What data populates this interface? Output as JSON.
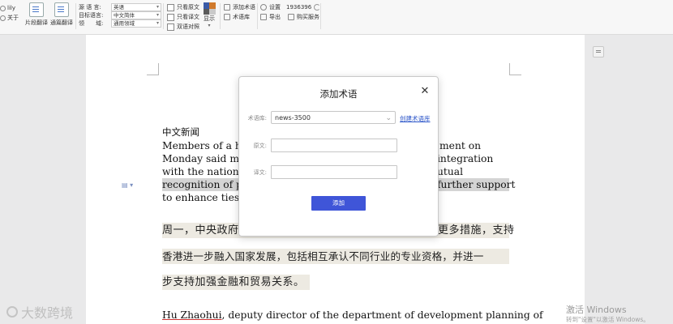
{
  "toolbar": {
    "user": "lily",
    "about": "关于",
    "segment_translate": "片段翻译",
    "full_translate": "通篇翻译",
    "source_lang_label": "源 语 言:",
    "source_lang_value": "英语",
    "target_lang_label": "目标语言:",
    "target_lang_value": "中文简体",
    "domain_label": "领　　域:",
    "domain_value": "通用领域",
    "view_source_only": "只看原文",
    "view_target_only": "只看译文",
    "bilingual_compare": "双语对照",
    "display": "显示",
    "add_term": "添加术语",
    "term_base": "术语库",
    "settings": "设置",
    "export": "导出",
    "credits": "1936396",
    "buy_service": "购买服务",
    "display_colors": [
      "#3a5ba8",
      "#d07a2c",
      "#5a5a5a",
      "#c9c9c9"
    ]
  },
  "document": {
    "heading": "中文新闻",
    "en_lines": [
      "Members of a hig",
      "Monday said mor",
      "with the national",
      "recognition of pro",
      "to enhance ties or"
    ],
    "en_right": [
      "ment on",
      "integration",
      "utual",
      "further support"
    ],
    "zh_lines": [
      "周一，中央政府",
      "香港进一步融入国家发展，包括相互承认不同行业的专业资格，并进一",
      "步支持加强金融和贸易关系。"
    ],
    "zh_right": "更多措施，支持",
    "last_line_name": "Hu Zhaohui",
    "last_line_rest": ", deputy director of the department of development planning of"
  },
  "dialog": {
    "title": "添加术语",
    "termbase_label": "术语库:",
    "termbase_value": "news-3500",
    "create_link": "创建术语库",
    "source_label": "原文:",
    "target_label": "译文:",
    "add_button": "添加"
  },
  "overlay": {
    "watermark_text": "大数跨境",
    "activate_title": "激活 Windows",
    "activate_sub": "转到\"设置\"以激活 Windows。"
  }
}
